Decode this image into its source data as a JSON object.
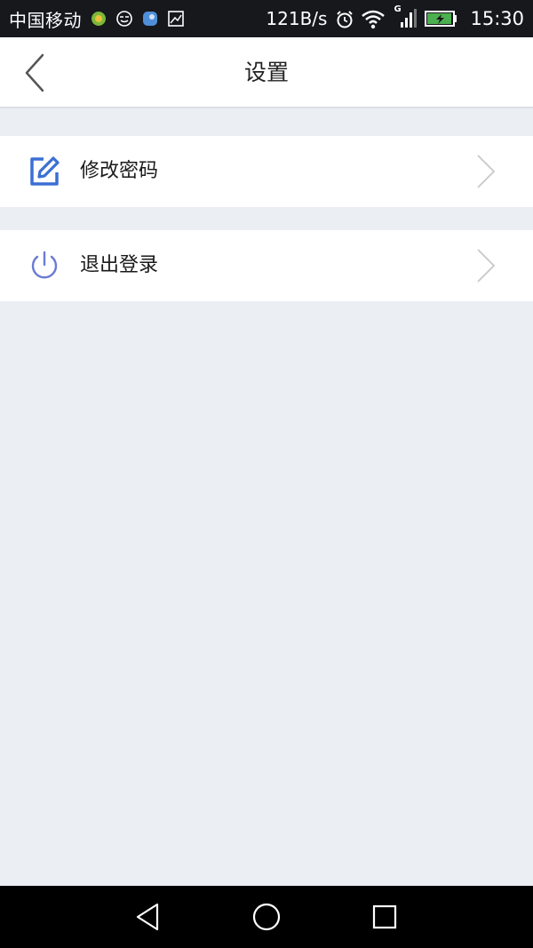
{
  "status_bar": {
    "carrier": "中国移动",
    "net_speed": "121B/s",
    "signal_type": "G",
    "time": "15:30",
    "icons": [
      "app-notification-icon",
      "emoji-notification-icon",
      "app-notification-icon-2",
      "image-notification-icon",
      "alarm-icon",
      "wifi-icon",
      "signal-icon",
      "battery-charging-icon"
    ]
  },
  "header": {
    "title": "设置",
    "back_icon": "chevron-left-icon"
  },
  "menu": {
    "items": [
      {
        "label": "修改密码",
        "icon": "edit-icon",
        "chevron": "chevron-right-icon"
      },
      {
        "label": "退出登录",
        "icon": "power-icon",
        "chevron": "chevron-right-icon"
      }
    ]
  },
  "nav_bar": {
    "buttons": [
      "back-triangle-icon",
      "home-circle-icon",
      "recent-square-icon"
    ]
  },
  "colors": {
    "status_bar_bg": "#16181c",
    "page_bg": "#ebeef3",
    "icon_blue": "#3b6fd4",
    "power_icon": "#6a7bd6",
    "chevron": "#c8c8c8"
  }
}
